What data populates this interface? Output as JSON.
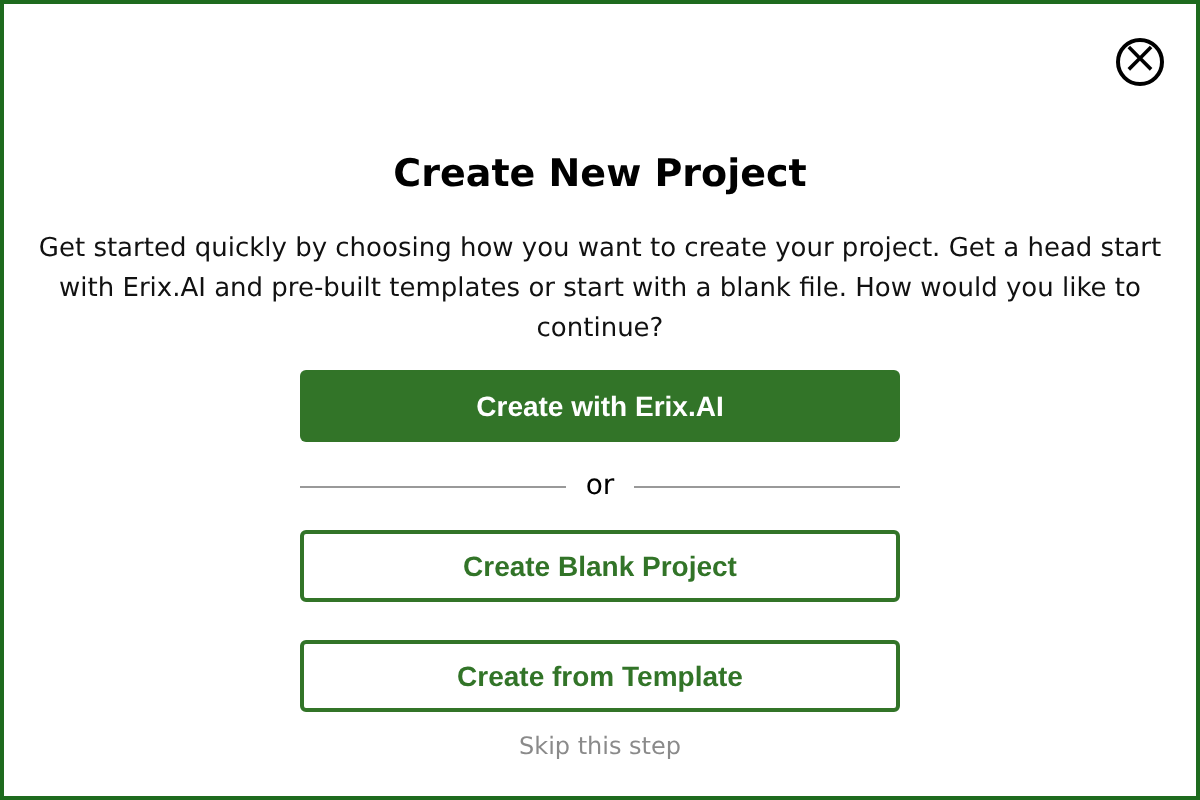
{
  "dialog": {
    "close_icon": "×",
    "title": "Create New Project",
    "description": "Get started quickly by choosing how you want to create your project. Get a head start with Erix.AI and pre-built templates or start with a blank file. How would you like to continue?",
    "primary_button": "Create with Erix.AI",
    "divider": "or",
    "buttons": [
      "Create Blank Project",
      "Create from Template"
    ],
    "skip_link": "Skip this step"
  }
}
